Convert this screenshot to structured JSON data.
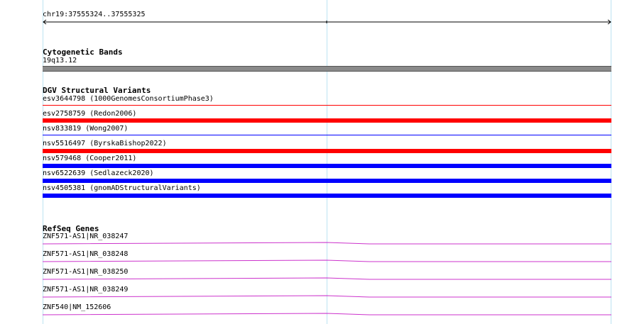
{
  "location": {
    "label": "chr19:37555324..37555325"
  },
  "tracks": {
    "cytoband": {
      "title": "Cytogenetic Bands",
      "band_label": "19q13.12",
      "band_color": "#8a8a8a"
    },
    "dgv": {
      "title": "DGV Structural Variants",
      "variants": [
        {
          "label": "esv3644798 (1000GenomesConsortiumPhase3)",
          "color": "#ff0000"
        },
        {
          "label": "esv2758759 (Redon2006)",
          "color": "#ff0000"
        },
        {
          "label": "nsv833819 (Wong2007)",
          "color": "#0000ff"
        },
        {
          "label": "nsv5516497 (ByrskaBishop2022)",
          "color": "#ff0000"
        },
        {
          "label": "nsv579468 (Cooper2011)",
          "color": "#0000ff"
        },
        {
          "label": "nsv6522639 (Sedlazeck2020)",
          "color": "#0000ff"
        },
        {
          "label": "nsv4505381 (gnomADStructuralVariants)",
          "color": "#0000ff"
        }
      ]
    },
    "refseq": {
      "title": "RefSeq Genes",
      "line_color": "#cc33cc",
      "genes": [
        {
          "label": "ZNF571-AS1|NR_038247"
        },
        {
          "label": "ZNF571-AS1|NR_038248"
        },
        {
          "label": "ZNF571-AS1|NR_038250"
        },
        {
          "label": "ZNF571-AS1|NR_038249"
        },
        {
          "label": "ZNF540|NM_152606"
        }
      ]
    }
  }
}
